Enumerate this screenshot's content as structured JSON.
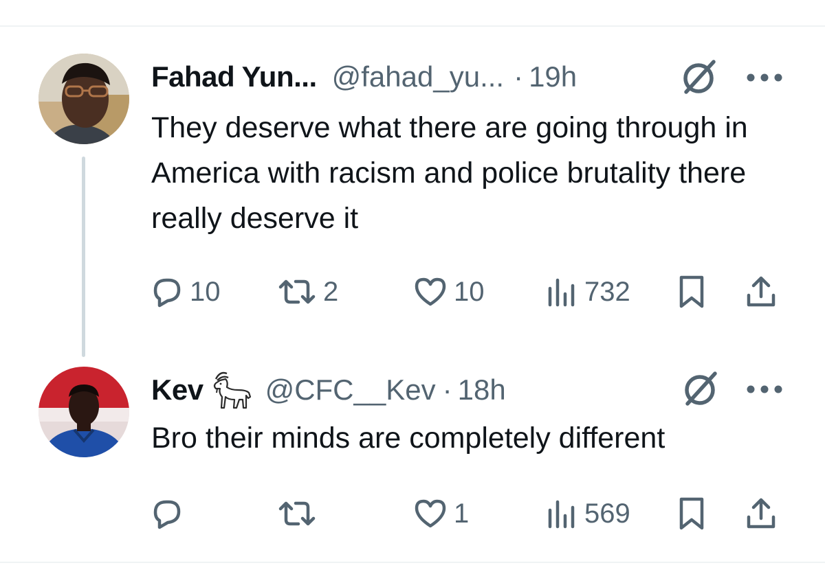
{
  "tweets": [
    {
      "display_name": "Fahad Yun...",
      "handle": "@fahad_yu...",
      "separator": "·",
      "time": "19h",
      "text": "They deserve what there are going through in America with racism and police brutality there really deserve it",
      "replies": "10",
      "retweets": "2",
      "likes": "10",
      "views": "732"
    },
    {
      "display_name": "Kev",
      "name_emoji_icon": "goat-icon",
      "handle": "@CFC__Kev",
      "separator": "·",
      "time": "18h",
      "text": "Bro their minds are completely different",
      "replies": "",
      "retweets": "",
      "likes": "1",
      "views": "569"
    }
  ],
  "icons": {
    "reply": "reply-icon",
    "retweet": "retweet-icon",
    "like": "heart-icon",
    "views": "views-icon",
    "bookmark": "bookmark-icon",
    "share": "share-icon",
    "grok": "grok-icon",
    "more": "more-icon"
  },
  "colors": {
    "text": "#0f1419",
    "secondary": "#536471",
    "divider": "#eff3f4",
    "thread_line": "#cfd9de"
  }
}
